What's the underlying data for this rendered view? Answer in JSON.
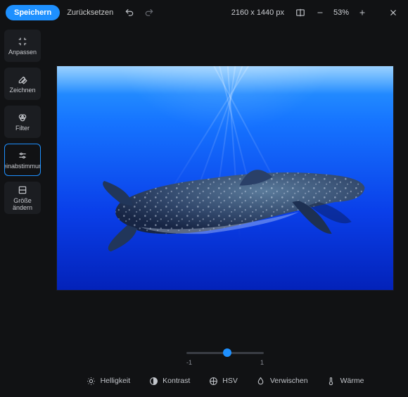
{
  "topbar": {
    "save_label": "Speichern",
    "reset_label": "Zurücksetzen",
    "dimensions": "2160 x 1440 px",
    "zoom": "53%"
  },
  "sidebar": {
    "items": [
      {
        "id": "fit",
        "label": "Anpassen"
      },
      {
        "id": "draw",
        "label": "Zeichnen"
      },
      {
        "id": "filter",
        "label": "Filter"
      },
      {
        "id": "finetune",
        "label": "einabstimmun"
      },
      {
        "id": "resize",
        "label": "Größe ändern"
      }
    ],
    "active_index": 3
  },
  "slider": {
    "min_label": "-1",
    "max_label": "1",
    "value": 0
  },
  "tabs": [
    {
      "id": "brightness",
      "label": "Helligkeit",
      "icon": "sun-icon"
    },
    {
      "id": "contrast",
      "label": "Kontrast",
      "icon": "contrast-icon"
    },
    {
      "id": "hsv",
      "label": "HSV",
      "icon": "hsv-icon"
    },
    {
      "id": "blur",
      "label": "Verwischen",
      "icon": "droplet-icon"
    },
    {
      "id": "warmth",
      "label": "Wärme",
      "icon": "thermometer-icon"
    }
  ],
  "image": {
    "subject": "whale shark underwater",
    "dominant_color": "#0a3fe9"
  }
}
